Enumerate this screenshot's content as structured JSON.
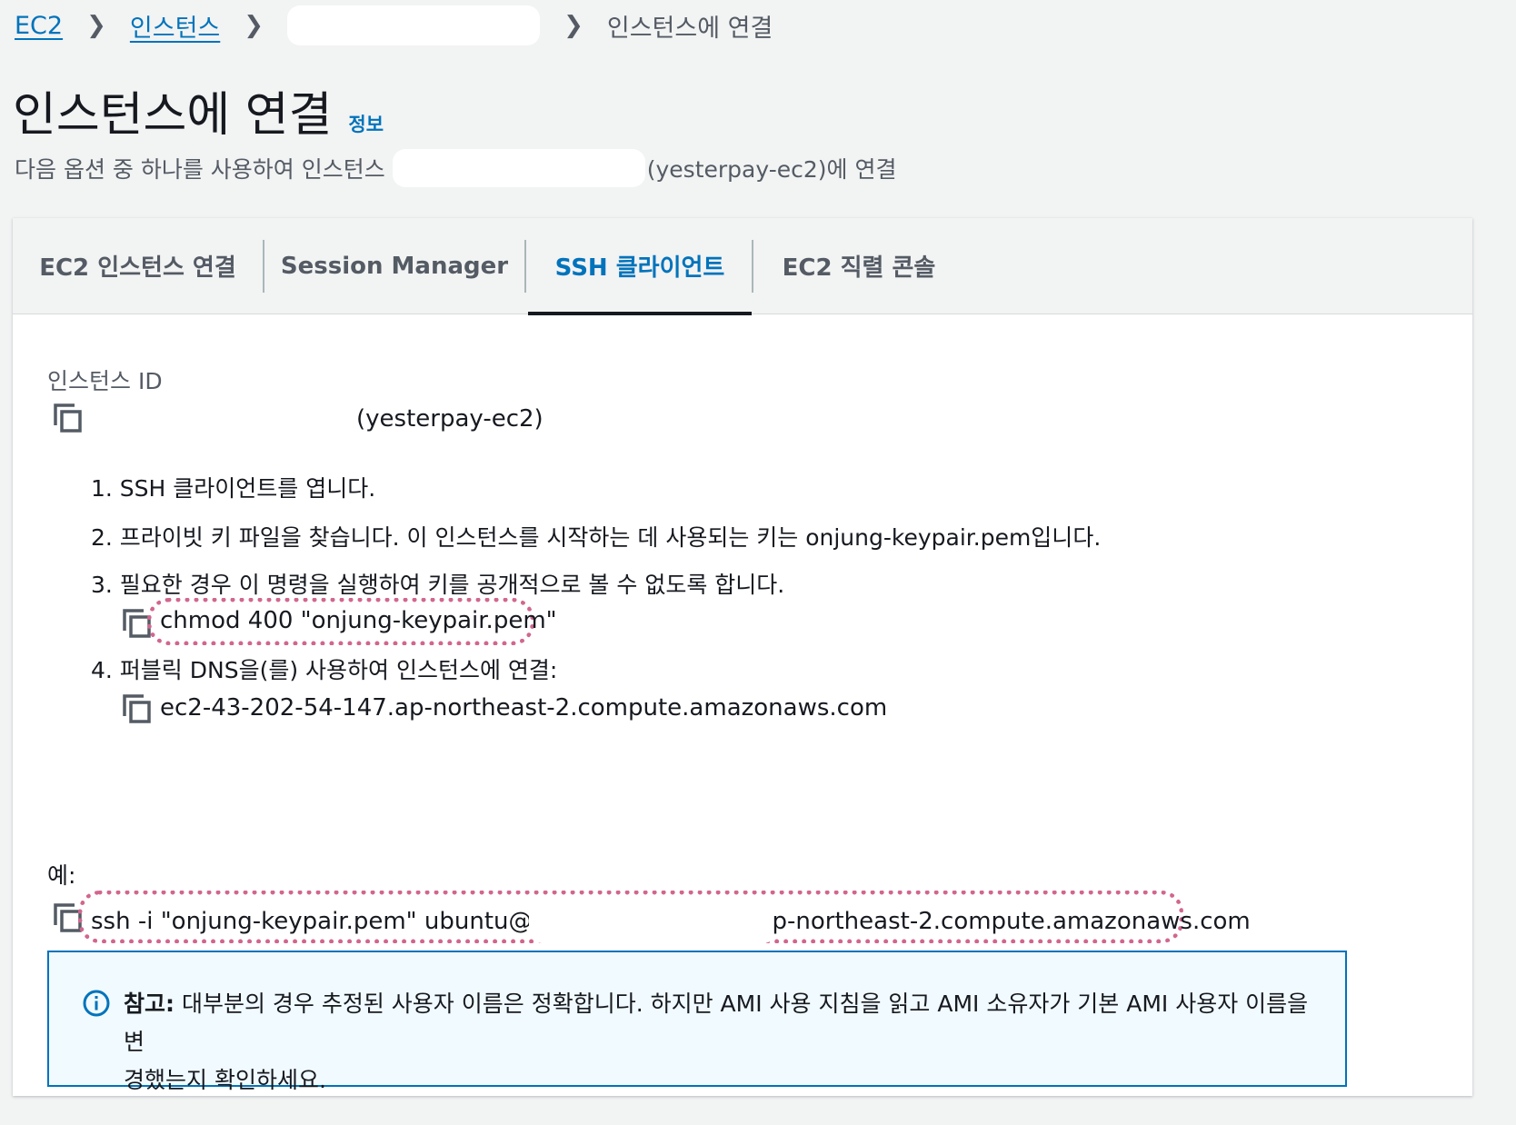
{
  "breadcrumb": {
    "items": [
      "EC2",
      "인스턴스"
    ],
    "current": "인스턴스에 연결"
  },
  "header": {
    "title": "인스턴스에 연결",
    "info": "정보",
    "subtitle_prefix": "다음 옵션 중 하나를 사용하여 인스턴스",
    "subtitle_suffix": "(yesterpay-ec2)에 연결"
  },
  "tabs": [
    {
      "label": "EC2 인스턴스 연결"
    },
    {
      "label": "Session Manager"
    },
    {
      "label": "SSH 클라이언트"
    },
    {
      "label": "EC2 직렬 콘솔"
    }
  ],
  "instance": {
    "label": "인스턴스 ID",
    "value": "(yesterpay-ec2)"
  },
  "steps": [
    "1. SSH 클라이언트를 엽니다.",
    "2. 프라이빗 키 파일을 찾습니다. 이 인스턴스를 시작하는 데 사용되는 키는 onjung-keypair.pem입니다.",
    "3. 필요한 경우 이 명령을 실행하여 키를 공개적으로 볼 수 없도록 합니다.",
    "4. 퍼블릭 DNS을(를) 사용하여 인스턴스에 연결:"
  ],
  "commands": {
    "chmod": "chmod 400 \"onjung-keypair.pem\"",
    "dns": "ec2-43-202-54-147.ap-northeast-2.compute.amazonaws.com"
  },
  "example": {
    "label": "예:",
    "ssh_prefix": "ssh -i \"onjung-keypair.pem\" ubuntu@",
    "ssh_suffix": "p-northeast-2.compute.amazonaws.com"
  },
  "alert": {
    "title": "참고:",
    "line1": "대부분의 경우 추정된 사용자 이름은 정확합니다. 하지만 AMI 사용 지침을 읽고 AMI 소유자가 기본 AMI 사용자 이름을 변",
    "line2": "경했는지 확인하세요."
  },
  "colors": {
    "link": "#0073bb",
    "highlight": "#d1668e",
    "alert_bg": "#f1faff"
  }
}
